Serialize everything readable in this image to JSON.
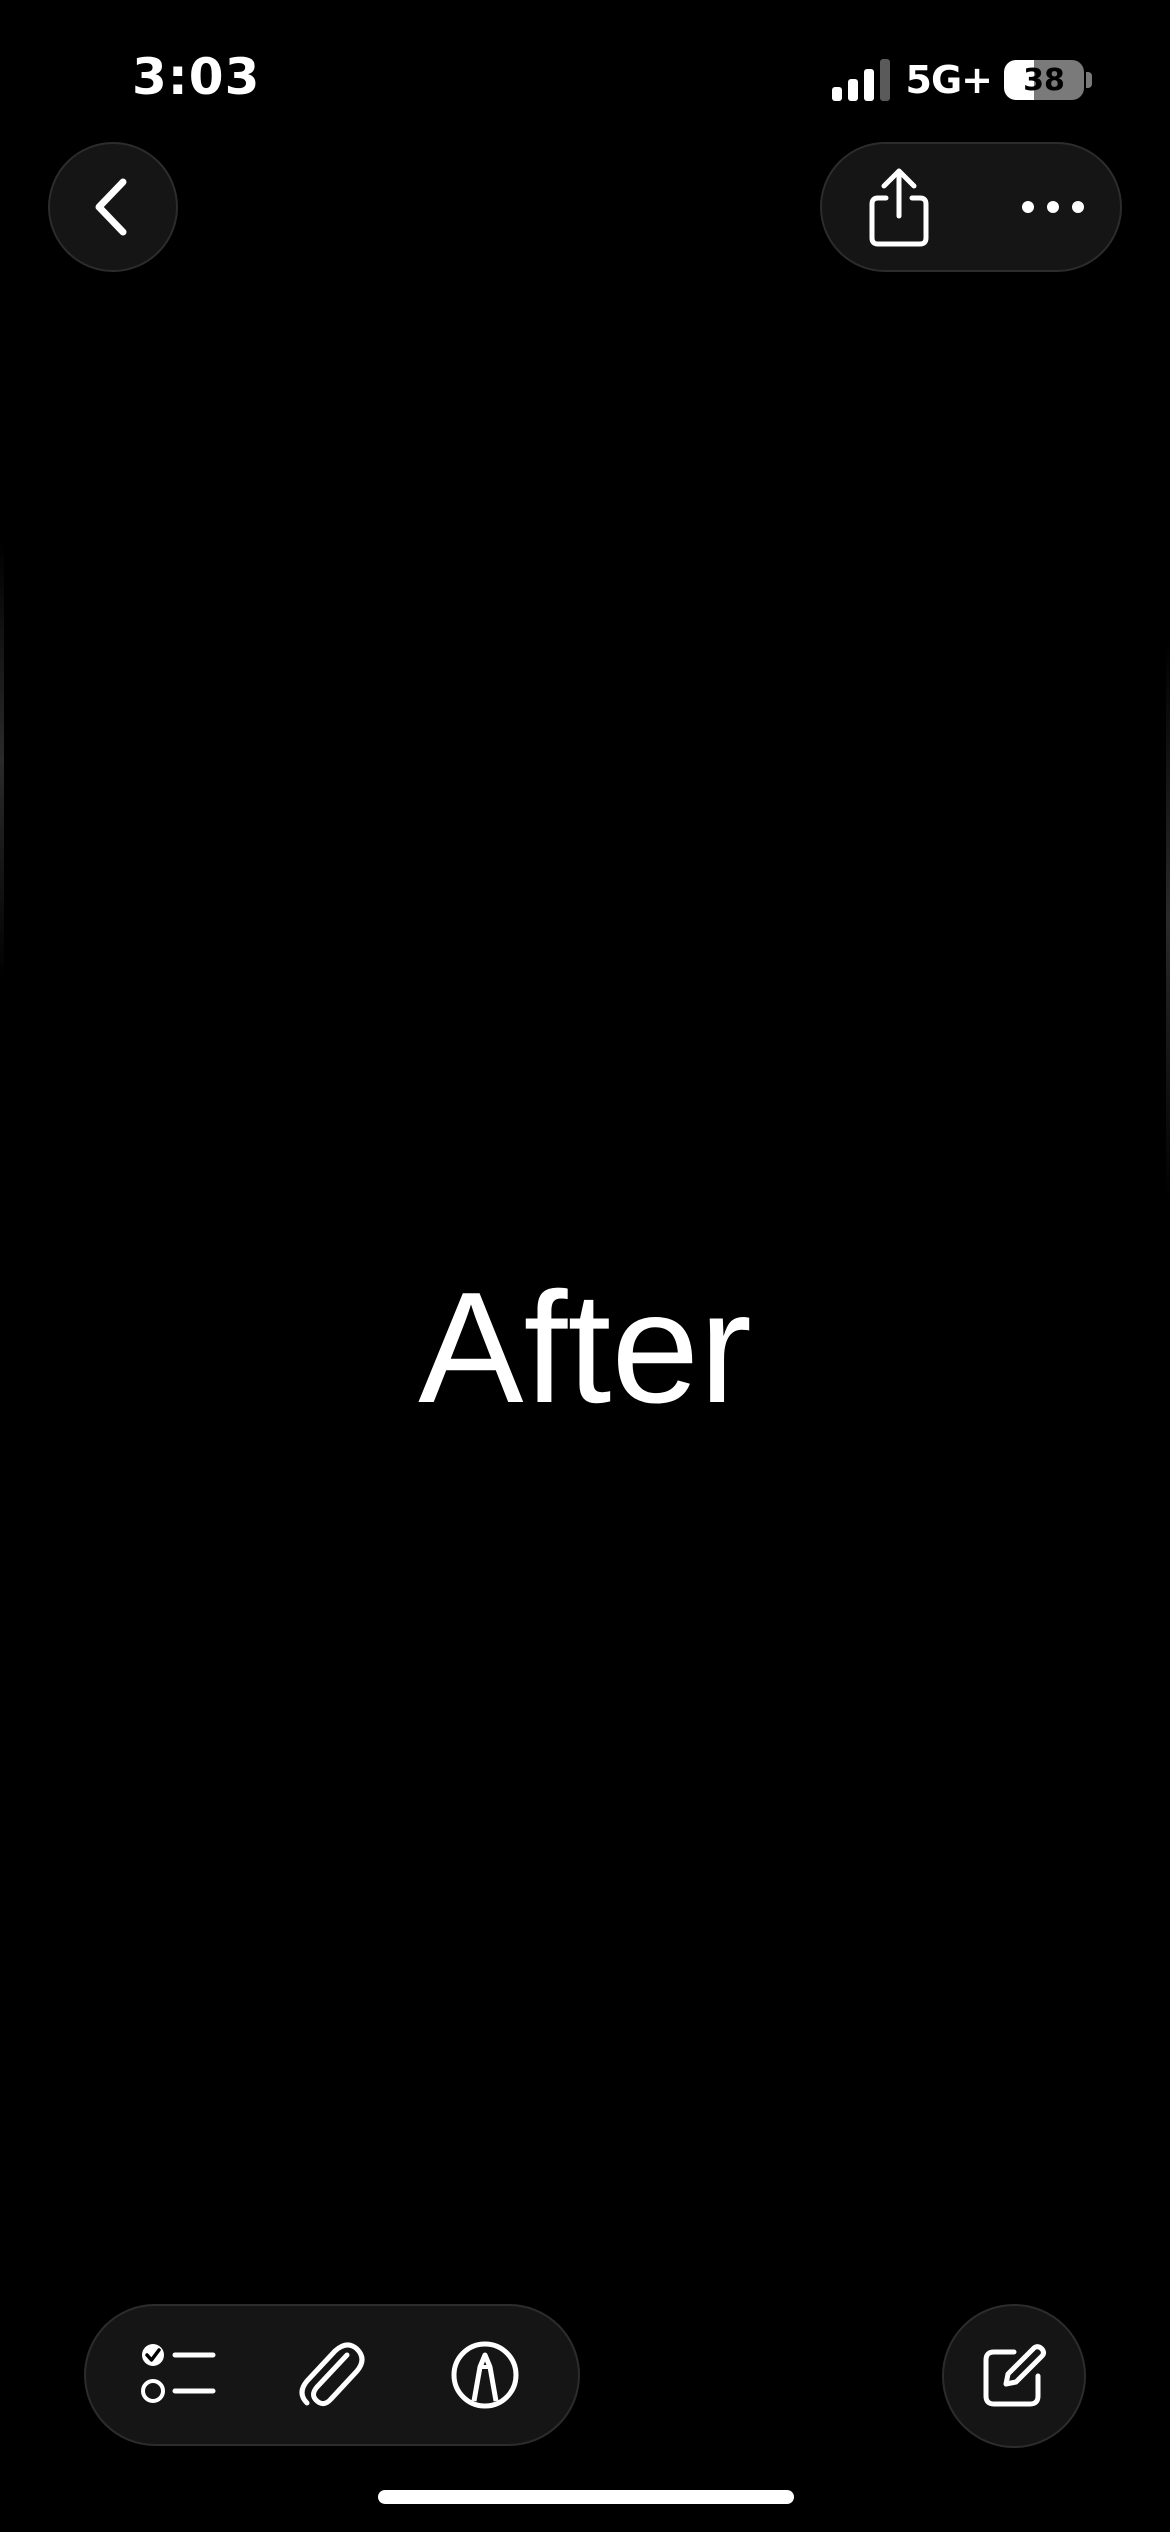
{
  "status_bar": {
    "time": "3:03",
    "network": "5G+",
    "battery_level": "38",
    "battery_fraction": 0.38,
    "signal_bars_filled": 3,
    "signal_bars_total": 4
  },
  "top_bar": {
    "back_icon": "chevron-left-icon",
    "share_icon": "share-icon",
    "more_icon": "more-horizontal-icon"
  },
  "note": {
    "body": "After"
  },
  "toolbar": {
    "checklist_icon": "checklist-icon",
    "attachment_icon": "paperclip-icon",
    "markup_icon": "markup-pen-icon",
    "compose_icon": "compose-icon"
  },
  "colors": {
    "background": "#000000",
    "button_fill": "#151515",
    "button_border": "#2c2c2c",
    "foreground": "#ffffff"
  }
}
